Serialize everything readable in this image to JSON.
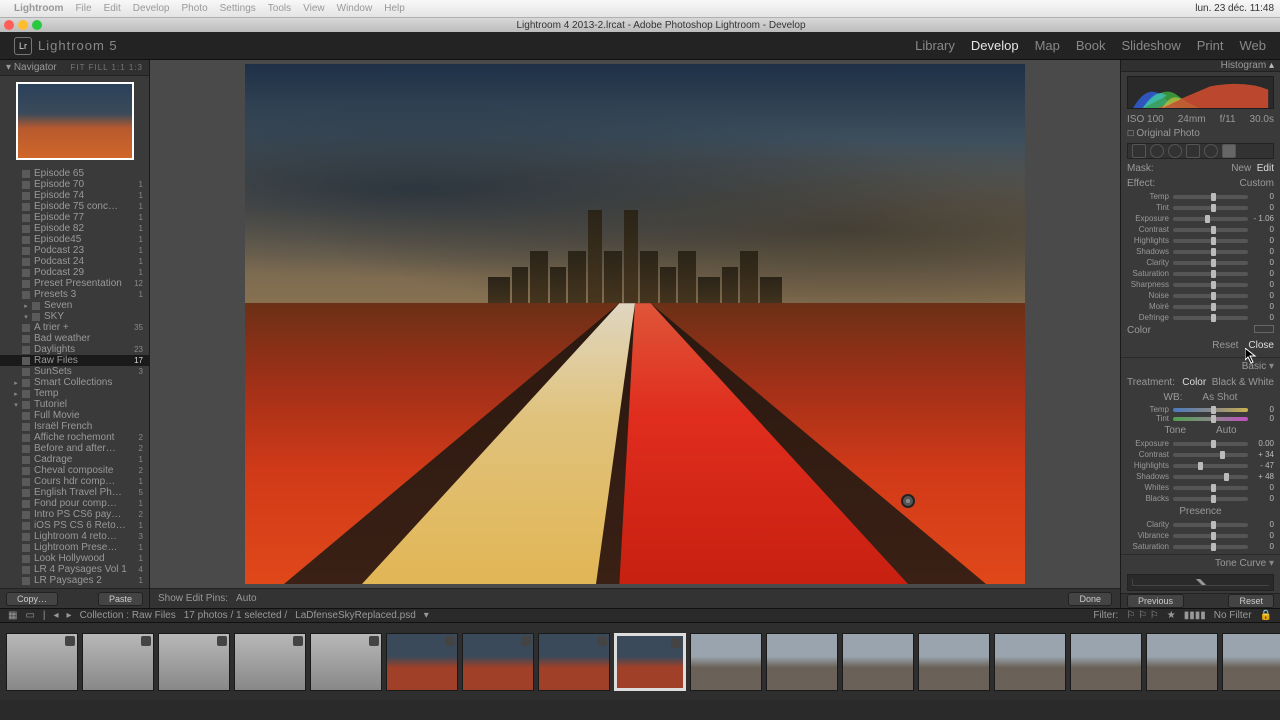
{
  "mac": {
    "app": "Lightroom",
    "menus": [
      "File",
      "Edit",
      "Develop",
      "Photo",
      "Settings",
      "Tools",
      "View",
      "Window",
      "Help"
    ],
    "right": "lun. 23 déc.  11:48"
  },
  "window": {
    "title": "Lightroom 4 2013-2.lrcat - Adobe Photoshop Lightroom - Develop"
  },
  "brand": "Lightroom 5",
  "modules": [
    "Library",
    "Develop",
    "Map",
    "Book",
    "Slideshow",
    "Print",
    "Web"
  ],
  "active_module": "Develop",
  "navigator": {
    "title": "Navigator",
    "zoom": "FIT  FILL  1:1  1:3"
  },
  "tree_header_folder": "",
  "tree": [
    {
      "label": "Episode 65",
      "count": ""
    },
    {
      "label": "Episode 70",
      "count": "1"
    },
    {
      "label": "Episode 74",
      "count": "1"
    },
    {
      "label": "Episode 75 conc…",
      "count": "1"
    },
    {
      "label": "Episode 77",
      "count": "1"
    },
    {
      "label": "Episode 82",
      "count": "1"
    },
    {
      "label": "Episode45",
      "count": "1"
    },
    {
      "label": "Podcast 23",
      "count": "1"
    },
    {
      "label": "Podcast 24",
      "count": "1"
    },
    {
      "label": "Podcast 29",
      "count": "1"
    },
    {
      "label": "Preset Presentation",
      "count": "12"
    },
    {
      "label": "Presets 3",
      "count": "1"
    }
  ],
  "tree_groups": [
    {
      "label": "Seven",
      "count": ""
    },
    {
      "label": "SKY",
      "count": "",
      "open": true
    }
  ],
  "tree_sky": [
    {
      "label": "A trier +",
      "count": "35"
    },
    {
      "label": "Bad weather",
      "count": ""
    },
    {
      "label": "Daylights",
      "count": "23"
    },
    {
      "label": "Raw Files",
      "count": "17",
      "sel": true
    },
    {
      "label": "SunSets",
      "count": "3"
    }
  ],
  "tree_after": [
    {
      "label": "Smart Collections",
      "hdr": true
    },
    {
      "label": "Temp",
      "hdr": true
    },
    {
      "label": "Tutoriel",
      "hdr": true,
      "open": true
    },
    {
      "label": "Full Movie",
      "count": ""
    },
    {
      "label": "Israël French",
      "count": ""
    },
    {
      "label": "Affiche rochemont",
      "count": "2"
    },
    {
      "label": "Before and after…",
      "count": "2"
    },
    {
      "label": "Cadrage",
      "count": "1"
    },
    {
      "label": "Cheval composite",
      "count": "2"
    },
    {
      "label": "Cours hdr comp…",
      "count": "1"
    },
    {
      "label": "English Travel Ph…",
      "count": "5"
    },
    {
      "label": "Fond pour comp…",
      "count": "1"
    },
    {
      "label": "Intro PS CS6 pay…",
      "count": "2"
    },
    {
      "label": "iOS PS CS 6 Reto…",
      "count": "1"
    },
    {
      "label": "Lightroom 4 reto…",
      "count": "3"
    },
    {
      "label": "Lightroom Prese…",
      "count": "1"
    },
    {
      "label": "Look Hollywood",
      "count": "1"
    },
    {
      "label": "LR 4 Paysages Vol 1",
      "count": "4"
    },
    {
      "label": "LR Paysages 2",
      "count": "1"
    }
  ],
  "left_foot": {
    "copy": "Copy…",
    "paste": "Paste"
  },
  "toolbar": {
    "pins": "Show Edit Pins:",
    "auto": "Auto",
    "done": "Done"
  },
  "right": {
    "histogram": "Histogram",
    "histo_strip": {
      "a": "ISO 100",
      "b": "24mm",
      "c": "f/11",
      "d": "30.0s"
    },
    "original": "Original Photo",
    "mask_head": {
      "mask": "Mask:",
      "new": "New",
      "edit": "Edit"
    },
    "brush": {
      "effect_lab": "Effect:",
      "effect_val": "Custom",
      "sliders": [
        {
          "lab": "Temp",
          "val": "0"
        },
        {
          "lab": "Tint",
          "val": "0"
        },
        {
          "lab": "Exposure",
          "val": "- 1.06",
          "pos": 42
        },
        {
          "lab": "Contrast",
          "val": "0"
        },
        {
          "lab": "Highlights",
          "val": "0"
        },
        {
          "lab": "Shadows",
          "val": "0"
        },
        {
          "lab": "Clarity",
          "val": "0"
        },
        {
          "lab": "Saturation",
          "val": "0"
        },
        {
          "lab": "Sharpness",
          "val": "0"
        },
        {
          "lab": "Noise",
          "val": "0"
        },
        {
          "lab": "Moiré",
          "val": "0"
        },
        {
          "lab": "Defringe",
          "val": "0"
        }
      ],
      "color": "Color",
      "reset": "Reset",
      "close": "Close"
    },
    "basic": {
      "head": "Basic",
      "treat": "Treatment:",
      "color": "Color",
      "bw": "Black & White",
      "wb": "WB:",
      "wb_val": "As Shot",
      "temp": "Temp",
      "tint": "Tint",
      "tone": "Tone",
      "auto": "Auto",
      "sliders": [
        {
          "lab": "Exposure",
          "val": "0.00"
        },
        {
          "lab": "Contrast",
          "val": "+ 34",
          "pos": 62
        },
        {
          "lab": "Highlights",
          "val": "- 47",
          "pos": 33
        },
        {
          "lab": "Shadows",
          "val": "+ 48",
          "pos": 68
        },
        {
          "lab": "Whites",
          "val": "0"
        },
        {
          "lab": "Blacks",
          "val": "0"
        }
      ],
      "presence": "Presence",
      "presence_sliders": [
        {
          "lab": "Clarity",
          "val": "0"
        },
        {
          "lab": "Vibrance",
          "val": "0"
        },
        {
          "lab": "Saturation",
          "val": "0"
        }
      ]
    },
    "tonecurve": "Tone Curve",
    "prev": "Previous",
    "reset": "Reset"
  },
  "status": {
    "coll": "Collection : Raw Files",
    "count": "17 photos / 1 selected /",
    "file": "LaDfenseSkyReplaced.psd",
    "filter": "Filter:",
    "nofilter": "No Filter"
  },
  "film_count": 17,
  "film_sel": 8,
  "chart_data": {
    "type": "area",
    "title": "Histogram",
    "xlabel": "",
    "ylabel": "",
    "xlim": [
      0,
      255
    ],
    "series": [
      {
        "name": "blue",
        "color": "#3060e0"
      },
      {
        "name": "green",
        "color": "#40c040"
      },
      {
        "name": "red",
        "color": "#e04030"
      }
    ],
    "note": "RGB histogram peaks: blue low-mid, green mid, heavy red in upper-mid clipping toward right"
  }
}
